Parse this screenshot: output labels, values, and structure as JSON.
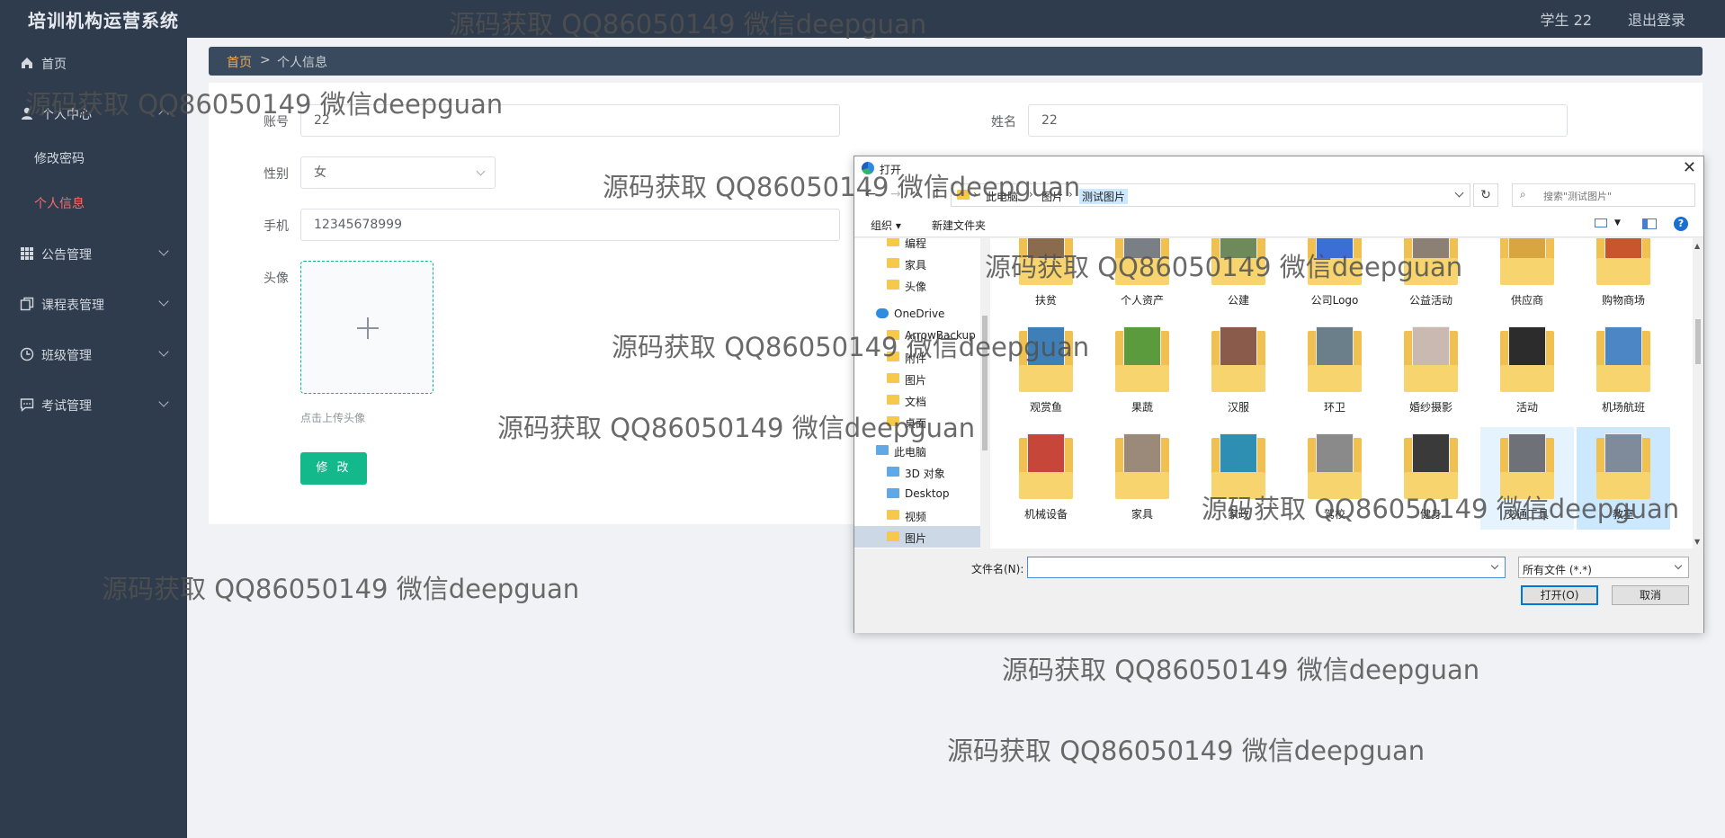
{
  "header": {
    "brand": "培训机构运营系统",
    "user": "学生 22",
    "logout": "退出登录"
  },
  "sidebar": {
    "items": [
      {
        "label": "首页",
        "icon": "home-icon"
      },
      {
        "label": "个人中心",
        "icon": "user-icon"
      },
      {
        "label": "公告管理",
        "icon": "grid-icon"
      },
      {
        "label": "课程表管理",
        "icon": "copy-icon"
      },
      {
        "label": "班级管理",
        "icon": "clock-icon"
      },
      {
        "label": "考试管理",
        "icon": "chat-icon"
      }
    ],
    "sub": [
      {
        "label": "修改密码"
      },
      {
        "label": "个人信息"
      }
    ]
  },
  "breadcrumb": {
    "home": "首页",
    "sep": ">",
    "current": "个人信息"
  },
  "form": {
    "account_label": "账号",
    "account_value": "22",
    "name_label": "姓名",
    "name_value": "22",
    "gender_label": "性别",
    "gender_value": "女",
    "phone_label": "手机",
    "phone_value": "12345678999",
    "avatar_label": "头像",
    "avatar_hint": "点击上传头像",
    "submit": "修 改"
  },
  "dialog": {
    "title": "打开",
    "nav": {
      "back": "←",
      "forward": "→",
      "recent": "⌄",
      "up": "↑",
      "refresh": "↻"
    },
    "crumbs": [
      "此电脑",
      "图片",
      "测试图片"
    ],
    "crumb_sep": "›",
    "search_placeholder": "搜索\"测试图片\"",
    "organize": "组织 ▾",
    "new_folder": "新建文件夹",
    "tree": [
      {
        "label": "编程"
      },
      {
        "label": "家具"
      },
      {
        "label": "头像"
      },
      {
        "label": "OneDrive"
      },
      {
        "label": "ArrowBackup"
      },
      {
        "label": "附件"
      },
      {
        "label": "图片"
      },
      {
        "label": "文档"
      },
      {
        "label": "桌面"
      },
      {
        "label": "此电脑"
      },
      {
        "label": "3D 对象"
      },
      {
        "label": "Desktop"
      },
      {
        "label": "视频"
      },
      {
        "label": "图片"
      }
    ],
    "files": [
      {
        "name": "扶贫",
        "color": "#8a6b4e"
      },
      {
        "name": "个人资产",
        "color": "#7a7f86"
      },
      {
        "name": "公建",
        "color": "#6f8a5a"
      },
      {
        "name": "公司Logo",
        "color": "#3b6fd6"
      },
      {
        "name": "公益活动",
        "color": "#8c8074"
      },
      {
        "name": "供应商",
        "color": "#d8a640"
      },
      {
        "name": "购物商场",
        "color": "#c8552e"
      },
      {
        "name": "观赏鱼",
        "color": "#3f7fb8"
      },
      {
        "name": "果蔬",
        "color": "#5c9a3e"
      },
      {
        "name": "汉服",
        "color": "#8a5a4a"
      },
      {
        "name": "环卫",
        "color": "#6b7f8a"
      },
      {
        "name": "婚纱摄影",
        "color": "#c9b9b0"
      },
      {
        "name": "活动",
        "color": "#2c2c2c"
      },
      {
        "name": "机场航班",
        "color": "#4d86c4"
      },
      {
        "name": "机械设备",
        "color": "#c7463a"
      },
      {
        "name": "家具",
        "color": "#9b8a7a"
      },
      {
        "name": "家政",
        "color": "#2e8fb3"
      },
      {
        "name": "驾校",
        "color": "#8a8a8a"
      },
      {
        "name": "健身",
        "color": "#3a3a3a"
      },
      {
        "name": "交通工具",
        "color": "#6e7278"
      },
      {
        "name": "教室",
        "color": "#7f8a9a"
      }
    ],
    "filename_label": "文件名(N):",
    "filename_value": "",
    "filetype": "所有文件 (*.*)",
    "open": "打开(O)",
    "cancel": "取消"
  },
  "watermark": "源码获取 QQ86050149 微信deepguan"
}
